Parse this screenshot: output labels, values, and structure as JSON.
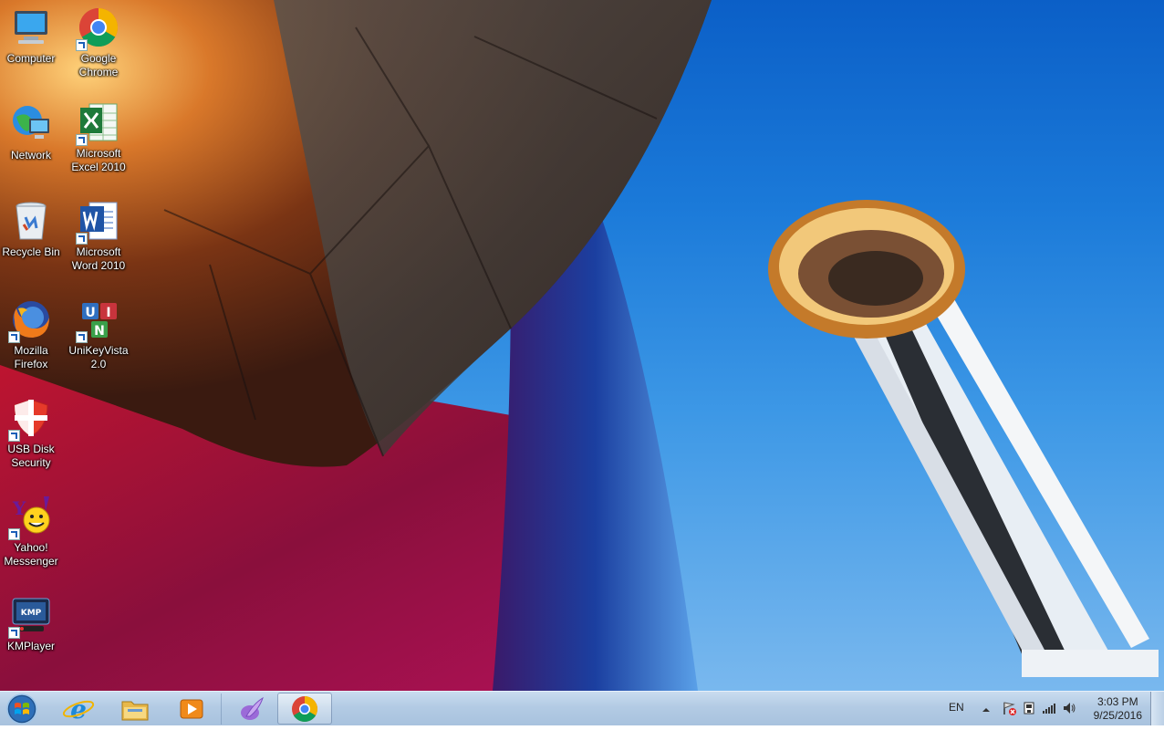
{
  "desktop": {
    "icons": [
      {
        "label": "Computer",
        "icon": "computer-icon"
      },
      {
        "label": "Google\nChrome",
        "icon": "chrome-icon"
      },
      {
        "label": "Network",
        "icon": "network-icon"
      },
      {
        "label": "Microsoft\nExcel 2010",
        "icon": "excel-icon"
      },
      {
        "label": "Recycle Bin",
        "icon": "recycle-bin-icon"
      },
      {
        "label": "Microsoft\nWord 2010",
        "icon": "word-icon"
      },
      {
        "label": "Mozilla\nFirefox",
        "icon": "firefox-icon"
      },
      {
        "label": "UniKeyVista\n2.0",
        "icon": "unikey-icon"
      },
      {
        "label": "USB Disk\nSecurity",
        "icon": "usb-disk-security-icon"
      },
      {
        "label": "Yahoo!\nMessenger",
        "icon": "yahoo-messenger-icon"
      },
      {
        "label": "KMPlayer",
        "icon": "kmplayer-icon"
      }
    ]
  },
  "taskbar": {
    "pinned": [
      "start-orb-icon",
      "internet-explorer-icon",
      "file-explorer-icon",
      "media-player-icon",
      "feather-app-icon",
      "chrome-icon"
    ],
    "tray": {
      "language": "EN",
      "time": "3:03 PM",
      "date": "9/25/2016"
    }
  },
  "colors": {
    "sky": "#1b7ad9",
    "taskbar": "#b3cbe4"
  }
}
